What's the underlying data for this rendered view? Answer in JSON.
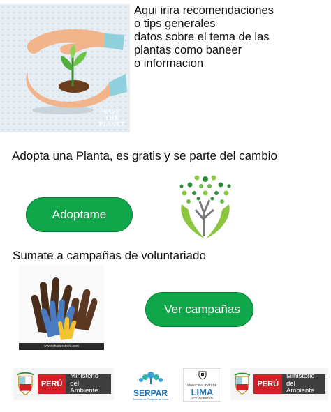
{
  "hero": {
    "watermark": [
      "SAVE",
      "THE",
      "PLANET"
    ],
    "text_lines": [
      "Aqui irira recomendaciones",
      "o tips generales",
      "datos sobre el tema de las",
      "plantas como baneer",
      "o informacion"
    ]
  },
  "adopt": {
    "heading": "Adopta una Planta, es gratis y se parte del cambio",
    "button_label": "Adoptame"
  },
  "volunteer": {
    "heading": "Sumate a campañas de voluntariado",
    "button_label": "Ver campañas",
    "image_caption": "www.shutterstock.com"
  },
  "logos": {
    "minam": {
      "country": "PERÚ",
      "line1": "Ministerio",
      "line2": "del Ambiente"
    },
    "serpar": {
      "name": "SERPAR",
      "tagline": "Servicio de Parques de Lima"
    },
    "lima": {
      "top": "MUNICIPALIDAD DE",
      "name": "LIMA",
      "bottom": "SOLIDARIDAD"
    }
  },
  "colors": {
    "button_green": "#0fa74a",
    "peru_red": "#d32027",
    "ministry_gray": "#3e3e3e"
  }
}
